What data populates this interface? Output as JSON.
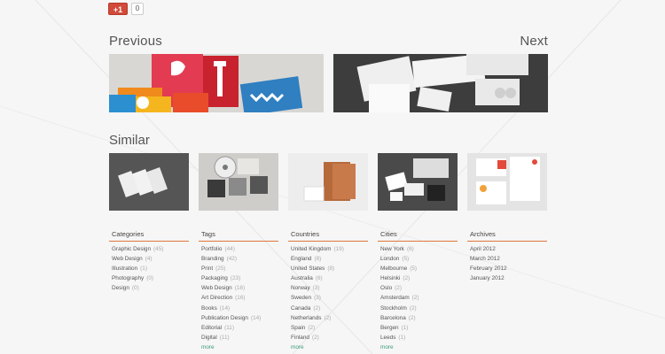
{
  "social": {
    "gplus_label": "+1",
    "gplus_count": "0"
  },
  "nav": {
    "previous": "Previous",
    "next": "Next"
  },
  "similar": {
    "title": "Similar"
  },
  "columns": [
    {
      "heading": "Categories",
      "items": [
        {
          "label": "Graphic Design",
          "count": "(45)"
        },
        {
          "label": "Web Design",
          "count": "(4)"
        },
        {
          "label": "Illustration",
          "count": "(1)"
        },
        {
          "label": "Photography",
          "count": "(0)"
        },
        {
          "label": "Design",
          "count": "(0)"
        }
      ]
    },
    {
      "heading": "Tags",
      "items": [
        {
          "label": "Portfolio",
          "count": "(44)"
        },
        {
          "label": "Branding",
          "count": "(42)"
        },
        {
          "label": "Print",
          "count": "(25)"
        },
        {
          "label": "Packaging",
          "count": "(23)"
        },
        {
          "label": "Web Design",
          "count": "(18)"
        },
        {
          "label": "Art Direction",
          "count": "(16)"
        },
        {
          "label": "Books",
          "count": "(14)"
        },
        {
          "label": "Publication Design",
          "count": "(14)"
        },
        {
          "label": "Editorial",
          "count": "(11)"
        },
        {
          "label": "Digital",
          "count": "(11)"
        }
      ],
      "more": "more"
    },
    {
      "heading": "Countries",
      "items": [
        {
          "label": "United Kingdom",
          "count": "(19)"
        },
        {
          "label": "England",
          "count": "(8)"
        },
        {
          "label": "United States",
          "count": "(8)"
        },
        {
          "label": "Australia",
          "count": "(6)"
        },
        {
          "label": "Norway",
          "count": "(3)"
        },
        {
          "label": "Sweden",
          "count": "(3)"
        },
        {
          "label": "Canada",
          "count": "(2)"
        },
        {
          "label": "Netherlands",
          "count": "(2)"
        },
        {
          "label": "Spain",
          "count": "(2)"
        },
        {
          "label": "Finland",
          "count": "(2)"
        }
      ],
      "more": "more"
    },
    {
      "heading": "Cities",
      "items": [
        {
          "label": "New York",
          "count": "(6)"
        },
        {
          "label": "London",
          "count": "(5)"
        },
        {
          "label": "Melbourne",
          "count": "(5)"
        },
        {
          "label": "Helsinki",
          "count": "(2)"
        },
        {
          "label": "Oslo",
          "count": "(2)"
        },
        {
          "label": "Amsterdam",
          "count": "(2)"
        },
        {
          "label": "Stockholm",
          "count": "(2)"
        },
        {
          "label": "Barcelona",
          "count": "(2)"
        },
        {
          "label": "Bergen",
          "count": "(1)"
        },
        {
          "label": "Leeds",
          "count": "(1)"
        }
      ],
      "more": "more"
    },
    {
      "heading": "Archives",
      "items": [
        {
          "label": "April 2012",
          "count": ""
        },
        {
          "label": "March 2012",
          "count": ""
        },
        {
          "label": "February 2012",
          "count": ""
        },
        {
          "label": "January 2012",
          "count": ""
        }
      ]
    }
  ],
  "colors": {
    "accent_line": "#e0763a",
    "more_link": "#3a9a7a",
    "background": "#f6f6f6"
  }
}
